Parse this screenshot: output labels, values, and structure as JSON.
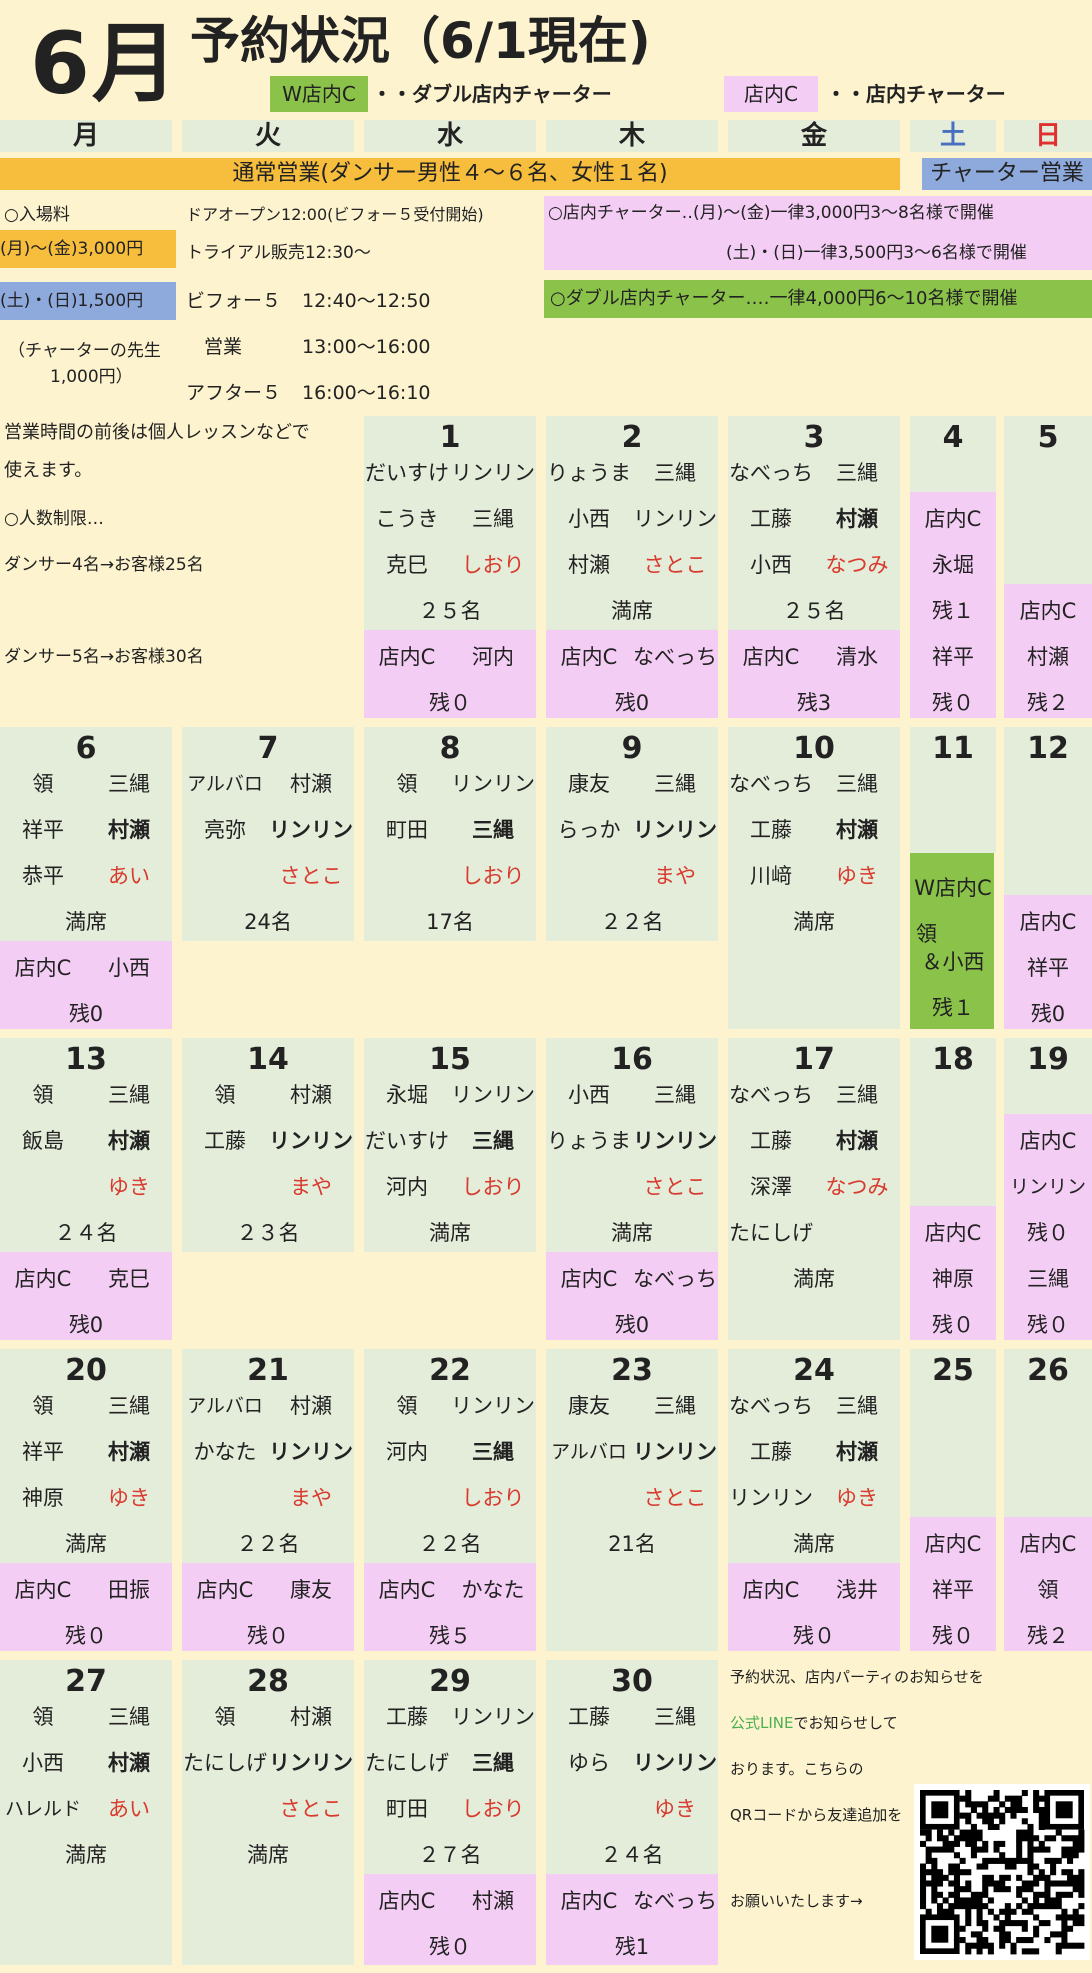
{
  "header": {
    "month": "6月",
    "title": "予約状況（6/1現在)",
    "legend": [
      {
        "tag": "W店内C",
        "text": "・・ダブル店内チャーター"
      },
      {
        "tag": "店内C",
        "text": "・・店内チャーター"
      }
    ]
  },
  "weekdays": [
    "月",
    "火",
    "水",
    "木",
    "金",
    "土",
    "日"
  ],
  "bars": {
    "normal": "通常営業(ダンサー男性４〜６名、女性１名)",
    "charter": "チャーター営業"
  },
  "info": {
    "fee_title": "○入場料",
    "fee_weekday": "(月)〜(金)3,000円",
    "fee_weekend": "(土)・(日)1,500円",
    "fee_teacher": "（チャーターの先生",
    "fee_teacher2": "1,000円）",
    "door_open": "ドアオープン12:00(ビフォー５受付開始)",
    "trial": "トライアル販売12:30〜",
    "before5_label": "ビフォー５",
    "before5_time": "12:40〜12:50",
    "business_label": "営業",
    "business_time": "13:00〜16:00",
    "after5_label": "アフター５",
    "after5_time": "16:00〜16:10",
    "charter_weekday": "○店内チャーター‥(月)〜(金)一律3,000円3〜8名様で開催",
    "charter_weekend": "(土)・(日)一律3,500円3〜6名様で開催",
    "double_charter": "○ダブル店内チャーター‥‥一律4,000円6〜10名様で開催",
    "lesson1": "営業時間の前後は個人レッスンなどで",
    "lesson2": "使えます。",
    "limit_title": "○人数制限…",
    "limit1": "ダンサー4名→お客様25名",
    "limit2": "ダンサー5名→お客様30名"
  },
  "days": {
    "d1": {
      "num": "1",
      "r1l": "だいすけ",
      "r1r": "リンリン",
      "r2l": "こうき",
      "r2r": "三縄",
      "r3l": "克巳",
      "r3r": "しおり",
      "count": "２５名",
      "c_tag": "店内C",
      "c_name": "河内",
      "c_rest": "残０"
    },
    "d2": {
      "num": "2",
      "r1l": "りょうま",
      "r1r": "三縄",
      "r2l": "小西",
      "r2r": "リンリン",
      "r3l": "村瀬",
      "r3r": "さとこ",
      "count": "満席",
      "c_tag": "店内C",
      "c_name": "なべっち",
      "c_rest": "残0"
    },
    "d3": {
      "num": "3",
      "r1l": "なべっち",
      "r1r": "三縄",
      "r2l": "工藤",
      "r2r": "村瀬",
      "r3l": "小西",
      "r3r": "なつみ",
      "count": "２５名",
      "c_tag": "店内C",
      "c_name": "清水",
      "c_rest": "残3"
    },
    "d4": {
      "num": "4",
      "a": "店内C",
      "b": "永堀",
      "c": "残１",
      "d": "祥平",
      "e": "残０"
    },
    "d5": {
      "num": "5",
      "a": "店内C",
      "b": "村瀬",
      "c": "残２"
    },
    "d6": {
      "num": "6",
      "r1l": "領",
      "r1r": "三縄",
      "r2l": "祥平",
      "r2r": "村瀬",
      "r3l": "恭平",
      "r3r": "あい",
      "count": "満席",
      "c_tag": "店内C",
      "c_name": "小西",
      "c_rest": "残0"
    },
    "d7": {
      "num": "7",
      "r1l": "アルバロ",
      "r1r": "村瀬",
      "r2l": "亮弥",
      "r2r": "リンリン",
      "r3r": "さとこ",
      "count": "24名"
    },
    "d8": {
      "num": "8",
      "r1l": "領",
      "r1r": "リンリン",
      "r2l": "町田",
      "r2r": "三縄",
      "r3r": "しおり",
      "count": "17名"
    },
    "d9": {
      "num": "9",
      "r1l": "康友",
      "r1r": "三縄",
      "r2l": "らっか",
      "r2r": "リンリン",
      "r3r": "まや",
      "count": "２２名"
    },
    "d10": {
      "num": "10",
      "r1l": "なべっち",
      "r1r": "三縄",
      "r2l": "工藤",
      "r2r": "村瀬",
      "r3l": "川﨑",
      "r3r": "ゆき",
      "count": "満席"
    },
    "d11": {
      "num": "11",
      "a": "W店内C",
      "b": "領",
      "c": "＆小西",
      "d": "残１"
    },
    "d12": {
      "num": "12",
      "a": "店内C",
      "b": "祥平",
      "c": "残0"
    },
    "d13": {
      "num": "13",
      "r1l": "領",
      "r1r": "三縄",
      "r2l": "飯島",
      "r2r": "村瀬",
      "r3r": "ゆき",
      "count": "２４名",
      "c_tag": "店内C",
      "c_name": "克巳",
      "c_rest": "残0"
    },
    "d14": {
      "num": "14",
      "r1l": "領",
      "r1r": "村瀬",
      "r2l": "工藤",
      "r2r": "リンリン",
      "r3r": "まや",
      "count": "２３名"
    },
    "d15": {
      "num": "15",
      "r1l": "永堀",
      "r1r": "リンリン",
      "r2l": "だいすけ",
      "r2r": "三縄",
      "r3l": "河内",
      "r3r": "しおり",
      "count": "満席"
    },
    "d16": {
      "num": "16",
      "r1l": "小西",
      "r1r": "三縄",
      "r2l": "りょうま",
      "r2r": "リンリン",
      "r3r": "さとこ",
      "count": "満席",
      "c_tag": "店内C",
      "c_name": "なべっち",
      "c_rest": "残0"
    },
    "d17": {
      "num": "17",
      "r1l": "なべっち",
      "r1r": "三縄",
      "r2l": "工藤",
      "r2r": "村瀬",
      "r3l": "深澤",
      "r3r": "なつみ",
      "r4l": "たにしげ",
      "count": "満席"
    },
    "d18": {
      "num": "18",
      "a": "店内C",
      "b": "神原",
      "c": "残０"
    },
    "d19": {
      "num": "19",
      "a": "店内C",
      "b": "リンリン",
      "c": "残０",
      "d": "三縄",
      "e": "残０"
    },
    "d20": {
      "num": "20",
      "r1l": "領",
      "r1r": "三縄",
      "r2l": "祥平",
      "r2r": "村瀬",
      "r3l": "神原",
      "r3r": "ゆき",
      "count": "満席",
      "c_tag": "店内C",
      "c_name": "田振",
      "c_rest": "残０"
    },
    "d21": {
      "num": "21",
      "r1l": "アルバロ",
      "r1r": "村瀬",
      "r2l": "かなた",
      "r2r": "リンリン",
      "r3r": "まや",
      "count": "２２名",
      "c_tag": "店内C",
      "c_name": "康友",
      "c_rest": "残０"
    },
    "d22": {
      "num": "22",
      "r1l": "領",
      "r1r": "リンリン",
      "r2l": "河内",
      "r2r": "三縄",
      "r3r": "しおり",
      "count": "２２名",
      "c_tag": "店内C",
      "c_name": "かなた",
      "c_rest": "残５"
    },
    "d23": {
      "num": "23",
      "r1l": "康友",
      "r1r": "三縄",
      "r2l": "アルバロ",
      "r2r": "リンリン",
      "r3r": "さとこ",
      "count": "21名"
    },
    "d24": {
      "num": "24",
      "r1l": "なべっち",
      "r1r": "三縄",
      "r2l": "工藤",
      "r2r": "村瀬",
      "r3l": "リンリン",
      "r3r": "ゆき",
      "count": "満席",
      "c_tag": "店内C",
      "c_name": "浅井",
      "c_rest": "残０"
    },
    "d25": {
      "num": "25",
      "a": "店内C",
      "b": "祥平",
      "c": "残０"
    },
    "d26": {
      "num": "26",
      "a": "店内C",
      "b": "領",
      "c": "残２"
    },
    "d27": {
      "num": "27",
      "r1l": "領",
      "r1r": "三縄",
      "r2l": "小西",
      "r2r": "村瀬",
      "r3l": "ハレルド",
      "r3r": "あい",
      "count": "満席"
    },
    "d28": {
      "num": "28",
      "r1l": "領",
      "r1r": "村瀬",
      "r2l": "たにしげ",
      "r2r": "リンリン",
      "r3r": "さとこ",
      "count": "満席"
    },
    "d29": {
      "num": "29",
      "r1l": "工藤",
      "r1r": "リンリン",
      "r2l": "たにしげ",
      "r2r": "三縄",
      "r3l": "町田",
      "r3r": "しおり",
      "count": "２７名",
      "c_tag": "店内C",
      "c_name": "村瀬",
      "c_rest": "残０"
    },
    "d30": {
      "num": "30",
      "r1l": "工藤",
      "r1r": "三縄",
      "r2l": "ゆら",
      "r2r": "リンリン",
      "r3r": "ゆき",
      "count": "２４名",
      "c_tag": "店内C",
      "c_name": "なべっち",
      "c_rest": "残1"
    }
  },
  "notice": {
    "line1": "予約状況、店内パーティのお知らせを",
    "line2a": "公式LINE",
    "line2b": "でお知らせして",
    "line3": "おります。こちらの",
    "line4": "QRコードから友達追加を",
    "line5": "お願いいたします→"
  },
  "colors": {
    "cream": "#fdf3cf",
    "light_green": "#e4ecda",
    "pink": "#f4cdf5",
    "green": "#8bc34a",
    "orange": "#f6be3c",
    "blue": "#8ea9db",
    "red": "#d93a2e",
    "line_green": "#4caf50"
  }
}
